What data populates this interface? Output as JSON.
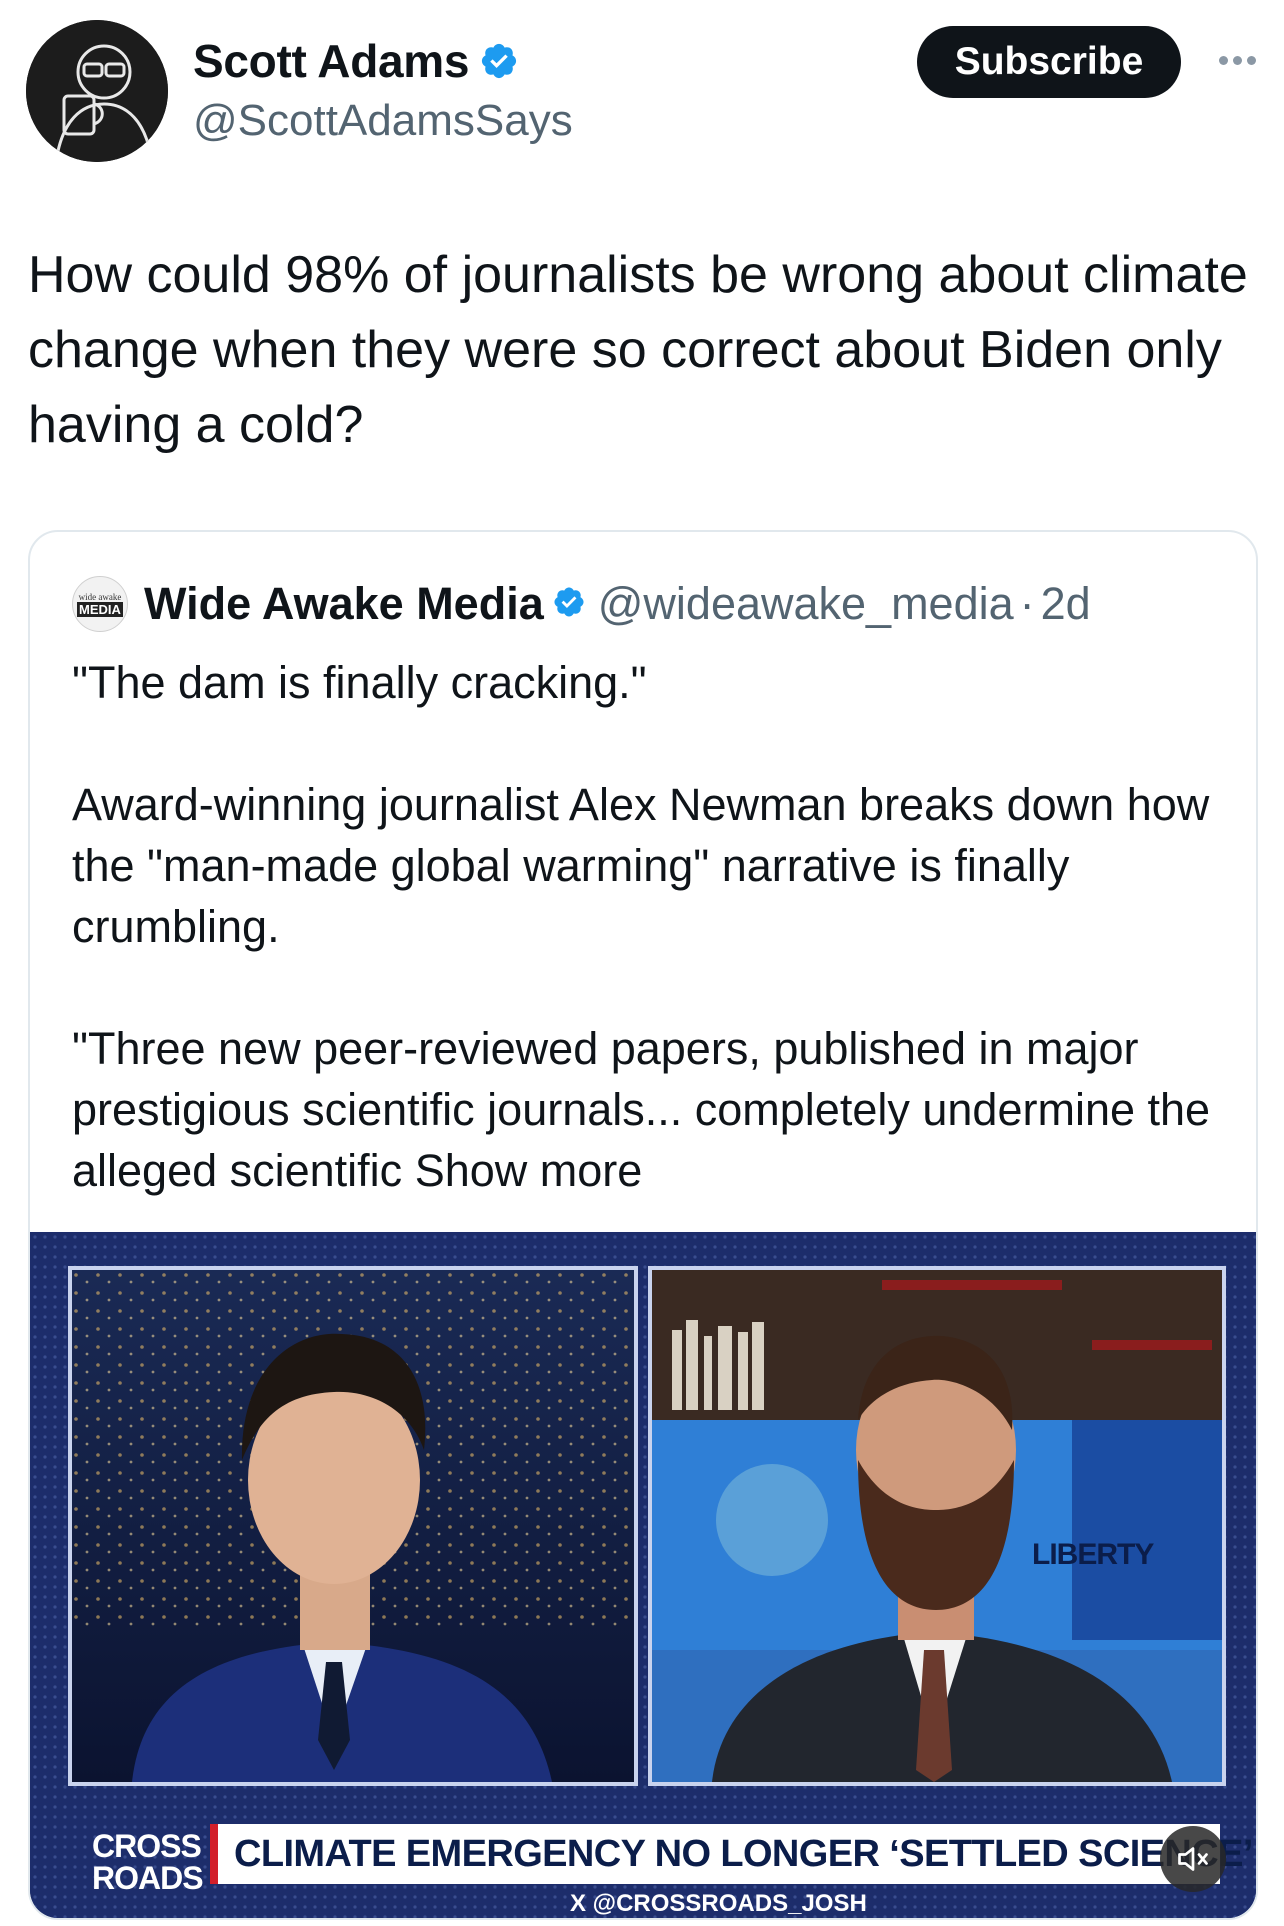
{
  "author": {
    "display_name": "Scott Adams",
    "handle": "@ScottAdamsSays",
    "avatar_icon": "avatar-sketch-icon",
    "verified_color": "#1d9bf0"
  },
  "actions": {
    "subscribe_label": "Subscribe",
    "more_icon": "more-horizontal-icon"
  },
  "tweet": {
    "text": "How could 98% of journalists be wrong about climate change when they were so correct about Biden only having a cold?"
  },
  "quoted": {
    "avatar_small": "wide awake",
    "avatar_big": "MEDIA",
    "display_name": "Wide Awake Media",
    "handle": "@wideawake_media",
    "separator": "·",
    "time": "2d",
    "paragraphs": [
      "\"The dam is finally cracking.\"",
      "Award-winning journalist Alex Newman breaks down how the \"man-made global warming\" narrative is finally crumbling.",
      "\"Three new peer-reviewed papers, published in major prestigious scientific journals... completely undermine the alleged scientific"
    ],
    "show_more": "Show more"
  },
  "video": {
    "brand_line1": "CROSS",
    "brand_line2": "ROADS",
    "headline": "CLIMATE EMERGENCY NO LONGER ‘SETTLED SCIENCE’",
    "credit": "X @CROSSROADS_JOSH",
    "backdrop_text": "LIBERTY",
    "mute_icon": "muted-speaker-icon"
  }
}
